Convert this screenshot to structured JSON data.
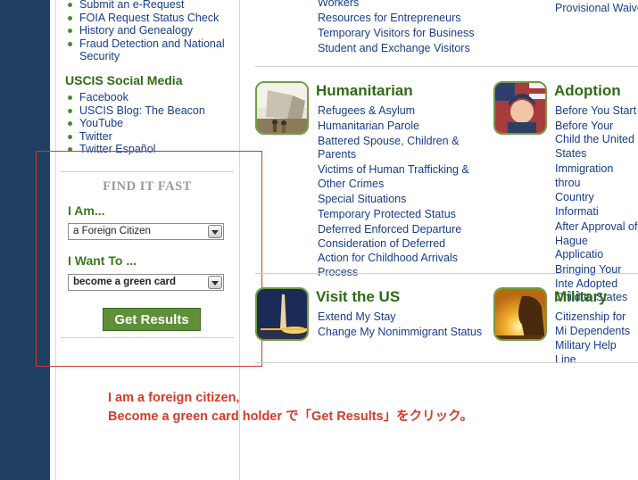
{
  "sidebar": {
    "top_links": [
      "Submit an e-Request",
      "FOIA Request Status Check",
      "History and Genealogy",
      "Fraud Detection and National Security"
    ],
    "social_heading": "USCIS Social Media",
    "social_links": [
      "Facebook",
      "USCIS Blog: The Beacon",
      "YouTube",
      "Twitter",
      "Twitter Español"
    ]
  },
  "find_it_fast": {
    "title": "FIND IT FAST",
    "i_am_label": "I Am...",
    "i_am_value": "a Foreign Citizen",
    "i_want_label": "I Want To ...",
    "i_want_value": "become a green card",
    "button_label": "Get Results"
  },
  "top_fragments": {
    "col1": [
      "Workers",
      "Resources for Entrepreneurs",
      "Temporary Visitors for Business",
      "Student and Exchange Visitors"
    ],
    "col2": "Provisional Waive"
  },
  "categories": {
    "humanitarian": {
      "heading": "Humanitarian",
      "links": [
        "Refugees & Asylum",
        "Humanitarian Parole",
        "Battered Spouse, Children & Parents",
        "Victims of Human Trafficking & Other Crimes",
        "Special Situations",
        "Temporary Protected Status",
        "Deferred Enforced Departure",
        "Consideration of Deferred Action for Childhood Arrivals Process"
      ]
    },
    "adoption": {
      "heading": "Adoption",
      "links": [
        "Before You Start",
        "Before Your Child the United States",
        "Immigration throu",
        "Country Informati",
        "After Approval of Hague Applicatio",
        "Bringing Your Inte Adopted Child to States"
      ]
    },
    "visit": {
      "heading": "Visit the US",
      "links": [
        "Extend My Stay",
        "Change My Nonimmigrant Status"
      ]
    },
    "military": {
      "heading": "Military",
      "links": [
        "Citizenship for Mi Dependents",
        "Military Help Line"
      ]
    }
  },
  "annotation": {
    "line1": "I am a foreign citizen,",
    "line2": "Become a green card holder で「Get Results」をクリック。"
  },
  "colors": {
    "left_bar": "#1f3f63",
    "link": "#173d8c",
    "heading_green": "#2f6b14",
    "button_green": "#5f8f39",
    "annotation_red": "#d83a27"
  }
}
